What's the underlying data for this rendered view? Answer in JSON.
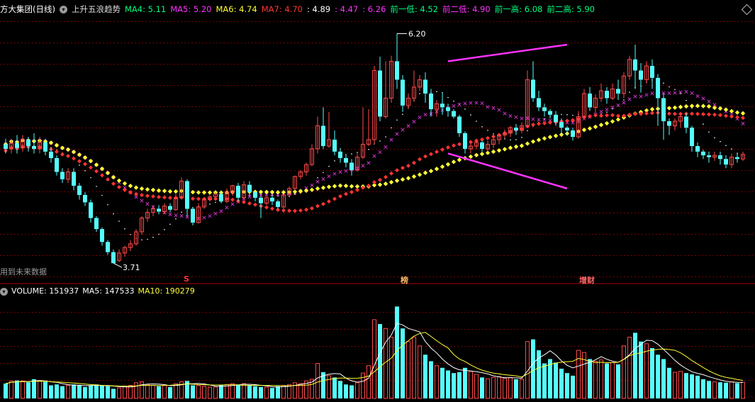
{
  "header": {
    "stock_name": "方大集团(日线)",
    "indicator_name": "上升五浪趋势",
    "items": [
      {
        "label": "MA4: 5.11",
        "color": "#00ff80"
      },
      {
        "label": "MA5: 5.20",
        "color": "#ff33ff"
      },
      {
        "label": "MA6: 4.74",
        "color": "#ffff33"
      },
      {
        "label": "MA7: 4.70",
        "color": "#ff3333"
      },
      {
        "label": ": 4.89",
        "color": "#ffffff"
      },
      {
        "label": ": 4.47",
        "color": "#ff33ff"
      },
      {
        "label": ": 6.26",
        "color": "#ff33ff"
      },
      {
        "label": "前一低: 4.52",
        "color": "#00ff80"
      },
      {
        "label": "前二低: 4.90",
        "color": "#ff33ff"
      },
      {
        "label": "前一高: 6.08",
        "color": "#00ff80"
      },
      {
        "label": "前二高: 5.90",
        "color": "#00ff80"
      }
    ]
  },
  "annotations": {
    "high_label": "6.20",
    "low_label": "3.71",
    "note": "用到未来数据",
    "markers": [
      {
        "text": "S",
        "color": "#ff3333"
      },
      {
        "text": "榜",
        "color": "#ffbb66"
      },
      {
        "text": "增财",
        "color": "#ff6666"
      }
    ]
  },
  "volume": {
    "items": [
      {
        "label": "VOLUME: 151937",
        "color": "#ffffff"
      },
      {
        "label": "MA5: 147533",
        "color": "#ffffff"
      },
      {
        "label": "MA10: 190279",
        "color": "#ffff33"
      }
    ]
  },
  "colors": {
    "up": "#ff4a4a",
    "down": "#55ffff",
    "grid": "#7a0000",
    "ma_white": "#ffffff",
    "ma_magenta": "#cc33cc",
    "ma_yellow": "#ffff33",
    "ma_red": "#ff3333",
    "trend_line": "#ff33ff"
  },
  "chart_data": {
    "type": "candlestick",
    "price_range": [
      3.55,
      6.38
    ],
    "volume_range": [
      0,
      230000
    ],
    "candles": [
      [
        5.0,
        4.95,
        5.06,
        4.9,
        34000
      ],
      [
        4.95,
        5.01,
        5.06,
        4.9,
        40000
      ],
      [
        5.01,
        4.96,
        5.1,
        4.9,
        41000
      ],
      [
        4.96,
        5.05,
        5.1,
        4.92,
        40000
      ],
      [
        5.05,
        4.98,
        5.08,
        4.92,
        37000
      ],
      [
        4.98,
        4.95,
        5.12,
        4.9,
        44000
      ],
      [
        4.95,
        5.02,
        5.08,
        4.9,
        41000
      ],
      [
        5.02,
        4.92,
        5.06,
        4.88,
        38000
      ],
      [
        4.92,
        4.85,
        4.96,
        4.8,
        30000
      ],
      [
        4.85,
        4.7,
        4.88,
        4.66,
        32000
      ],
      [
        4.7,
        4.62,
        4.74,
        4.58,
        28000
      ],
      [
        4.62,
        4.7,
        4.74,
        4.58,
        30000
      ],
      [
        4.7,
        4.55,
        4.74,
        4.5,
        32000
      ],
      [
        4.55,
        4.45,
        4.58,
        4.4,
        30000
      ],
      [
        4.45,
        4.37,
        4.48,
        4.33,
        26000
      ],
      [
        4.37,
        4.2,
        4.4,
        4.15,
        30000
      ],
      [
        4.2,
        4.08,
        4.22,
        4.05,
        32000
      ],
      [
        4.08,
        3.94,
        4.1,
        3.9,
        30000
      ],
      [
        3.94,
        3.83,
        3.96,
        3.8,
        28000
      ],
      [
        3.83,
        3.71,
        3.86,
        3.71,
        22000
      ],
      [
        3.74,
        3.82,
        3.86,
        3.72,
        24000
      ],
      [
        3.82,
        3.88,
        3.9,
        3.78,
        28000
      ],
      [
        3.88,
        3.92,
        3.96,
        3.84,
        30000
      ],
      [
        3.92,
        4.05,
        4.08,
        3.9,
        36000
      ],
      [
        4.05,
        4.2,
        4.22,
        4.02,
        38000
      ],
      [
        4.2,
        4.26,
        4.3,
        4.16,
        32000
      ],
      [
        4.26,
        4.3,
        4.34,
        4.22,
        30000
      ],
      [
        4.3,
        4.27,
        4.34,
        4.24,
        28000
      ],
      [
        4.27,
        4.33,
        4.36,
        4.24,
        30000
      ],
      [
        4.33,
        4.29,
        4.36,
        4.26,
        26000
      ],
      [
        4.29,
        4.42,
        4.46,
        4.28,
        34000
      ],
      [
        4.42,
        4.6,
        4.64,
        4.4,
        38000
      ],
      [
        4.6,
        4.3,
        4.62,
        4.22,
        40000
      ],
      [
        4.3,
        4.15,
        4.32,
        4.12,
        30000
      ],
      [
        4.15,
        4.32,
        4.36,
        4.14,
        30000
      ],
      [
        4.32,
        4.4,
        4.42,
        4.3,
        28000
      ],
      [
        4.4,
        4.43,
        4.45,
        4.38,
        26000
      ],
      [
        4.43,
        4.46,
        4.48,
        4.4,
        26000
      ],
      [
        4.46,
        4.38,
        4.5,
        4.36,
        30000
      ],
      [
        4.38,
        4.48,
        4.52,
        4.36,
        32000
      ],
      [
        4.48,
        4.55,
        4.56,
        4.44,
        34000
      ],
      [
        4.55,
        4.42,
        4.58,
        4.38,
        32000
      ],
      [
        4.42,
        4.56,
        4.6,
        4.4,
        34000
      ],
      [
        4.56,
        4.48,
        4.6,
        4.44,
        30000
      ],
      [
        4.48,
        4.42,
        4.5,
        4.38,
        28000
      ],
      [
        4.42,
        4.36,
        4.44,
        4.2,
        26000
      ],
      [
        4.36,
        4.42,
        4.44,
        4.34,
        26000
      ],
      [
        4.42,
        4.38,
        4.44,
        4.34,
        24000
      ],
      [
        4.38,
        4.32,
        4.4,
        4.3,
        28000
      ],
      [
        4.32,
        4.45,
        4.46,
        4.3,
        30000
      ],
      [
        4.45,
        4.52,
        4.54,
        4.44,
        32000
      ],
      [
        4.52,
        4.65,
        4.66,
        4.5,
        36000
      ],
      [
        4.65,
        4.7,
        4.72,
        4.62,
        34000
      ],
      [
        4.7,
        4.78,
        4.8,
        4.66,
        40000
      ],
      [
        4.78,
        4.95,
        5.0,
        4.76,
        44000
      ],
      [
        4.95,
        5.2,
        5.3,
        4.9,
        80000
      ],
      [
        5.2,
        4.98,
        5.4,
        4.95,
        60000
      ],
      [
        4.98,
        5.05,
        5.35,
        4.96,
        52000
      ],
      [
        5.05,
        4.92,
        5.15,
        4.88,
        48000
      ],
      [
        4.92,
        4.85,
        4.96,
        4.8,
        40000
      ],
      [
        4.85,
        4.8,
        4.88,
        4.75,
        32000
      ],
      [
        4.8,
        4.72,
        4.84,
        4.66,
        30000
      ],
      [
        4.72,
        4.86,
        4.9,
        4.7,
        36000
      ],
      [
        4.86,
        5.0,
        5.4,
        4.84,
        58000
      ],
      [
        5.0,
        5.05,
        5.38,
        4.98,
        75000
      ],
      [
        5.05,
        5.8,
        5.85,
        5.0,
        180000
      ],
      [
        5.8,
        5.3,
        5.95,
        5.25,
        170000
      ],
      [
        5.3,
        5.5,
        5.9,
        5.28,
        160000
      ],
      [
        5.5,
        5.9,
        5.96,
        5.45,
        140000
      ],
      [
        5.9,
        5.7,
        6.2,
        5.6,
        210000
      ],
      [
        5.7,
        5.42,
        5.75,
        5.35,
        160000
      ],
      [
        5.42,
        5.5,
        5.55,
        5.38,
        130000
      ],
      [
        5.5,
        5.62,
        5.8,
        5.46,
        140000
      ],
      [
        5.62,
        5.7,
        5.75,
        5.58,
        120000
      ],
      [
        5.7,
        5.55,
        5.78,
        5.45,
        100000
      ],
      [
        5.55,
        5.38,
        5.6,
        5.3,
        85000
      ],
      [
        5.38,
        5.44,
        5.48,
        5.3,
        75000
      ],
      [
        5.44,
        5.4,
        5.56,
        5.32,
        70000
      ],
      [
        5.4,
        5.36,
        5.44,
        5.3,
        64000
      ],
      [
        5.36,
        5.3,
        5.38,
        5.28,
        58000
      ],
      [
        5.3,
        5.12,
        5.32,
        5.08,
        60000
      ],
      [
        5.12,
        4.95,
        5.14,
        4.9,
        70000
      ],
      [
        4.95,
        4.98,
        5.02,
        4.9,
        62000
      ],
      [
        4.98,
        5.02,
        5.06,
        4.95,
        55000
      ],
      [
        5.02,
        4.95,
        5.04,
        4.92,
        48000
      ],
      [
        4.95,
        5.0,
        5.04,
        4.92,
        45000
      ],
      [
        5.0,
        5.05,
        5.1,
        4.96,
        48000
      ],
      [
        5.05,
        5.1,
        5.12,
        5.0,
        50000
      ],
      [
        5.1,
        5.12,
        5.16,
        5.06,
        46000
      ],
      [
        5.12,
        5.18,
        5.2,
        5.08,
        48000
      ],
      [
        5.18,
        5.15,
        5.22,
        5.1,
        44000
      ],
      [
        5.15,
        5.2,
        5.24,
        5.12,
        44000
      ],
      [
        5.2,
        5.7,
        5.8,
        5.18,
        130000
      ],
      [
        5.7,
        5.5,
        5.9,
        5.46,
        135000
      ],
      [
        5.5,
        5.4,
        5.58,
        5.36,
        110000
      ],
      [
        5.4,
        5.36,
        5.44,
        5.3,
        80000
      ],
      [
        5.36,
        5.32,
        5.38,
        5.28,
        90000
      ],
      [
        5.32,
        5.24,
        5.36,
        5.2,
        82000
      ],
      [
        5.24,
        5.18,
        5.28,
        5.12,
        68000
      ],
      [
        5.18,
        5.15,
        5.2,
        5.1,
        58000
      ],
      [
        5.15,
        5.08,
        5.18,
        5.04,
        52000
      ],
      [
        5.08,
        5.3,
        5.36,
        5.06,
        110000
      ],
      [
        5.3,
        5.55,
        5.6,
        5.28,
        105000
      ],
      [
        5.55,
        5.4,
        5.62,
        5.36,
        90000
      ],
      [
        5.4,
        5.5,
        5.54,
        5.34,
        85000
      ],
      [
        5.5,
        5.58,
        5.66,
        5.46,
        88000
      ],
      [
        5.58,
        5.5,
        5.62,
        5.44,
        80000
      ],
      [
        5.5,
        5.6,
        5.66,
        5.48,
        82000
      ],
      [
        5.6,
        5.55,
        5.7,
        5.48,
        78000
      ],
      [
        5.55,
        5.74,
        5.78,
        5.5,
        120000
      ],
      [
        5.74,
        5.92,
        5.96,
        5.7,
        140000
      ],
      [
        5.92,
        5.8,
        6.08,
        5.6,
        150000
      ],
      [
        5.8,
        5.7,
        5.88,
        5.56,
        130000
      ],
      [
        5.7,
        5.85,
        5.9,
        5.66,
        125000
      ],
      [
        5.85,
        5.72,
        5.92,
        5.6,
        115000
      ],
      [
        5.72,
        5.5,
        5.76,
        5.2,
        100000
      ],
      [
        5.5,
        5.25,
        5.55,
        5.05,
        90000
      ],
      [
        5.25,
        5.2,
        5.28,
        5.1,
        70000
      ],
      [
        5.2,
        5.25,
        5.28,
        5.15,
        60000
      ],
      [
        5.25,
        5.3,
        5.33,
        5.18,
        62000
      ],
      [
        5.3,
        5.18,
        5.34,
        5.12,
        58000
      ],
      [
        5.18,
        4.98,
        5.2,
        4.92,
        55000
      ],
      [
        4.98,
        4.92,
        5.02,
        4.86,
        52000
      ],
      [
        4.92,
        4.88,
        4.94,
        4.84,
        44000
      ],
      [
        4.88,
        4.86,
        4.92,
        4.8,
        40000
      ],
      [
        4.86,
        4.88,
        4.92,
        4.82,
        38000
      ],
      [
        4.88,
        4.84,
        4.92,
        4.78,
        37000
      ],
      [
        4.84,
        4.78,
        4.88,
        4.74,
        36000
      ],
      [
        4.78,
        4.86,
        4.9,
        4.74,
        38000
      ],
      [
        4.86,
        4.84,
        4.9,
        4.8,
        35000
      ],
      [
        4.84,
        4.89,
        4.92,
        4.82,
        37000
      ]
    ],
    "trend_lines": [
      [
        [
          78,
          5.9
        ],
        [
          99,
          6.08
        ]
      ],
      [
        [
          78,
          4.9
        ],
        [
          99,
          4.52
        ]
      ]
    ]
  }
}
